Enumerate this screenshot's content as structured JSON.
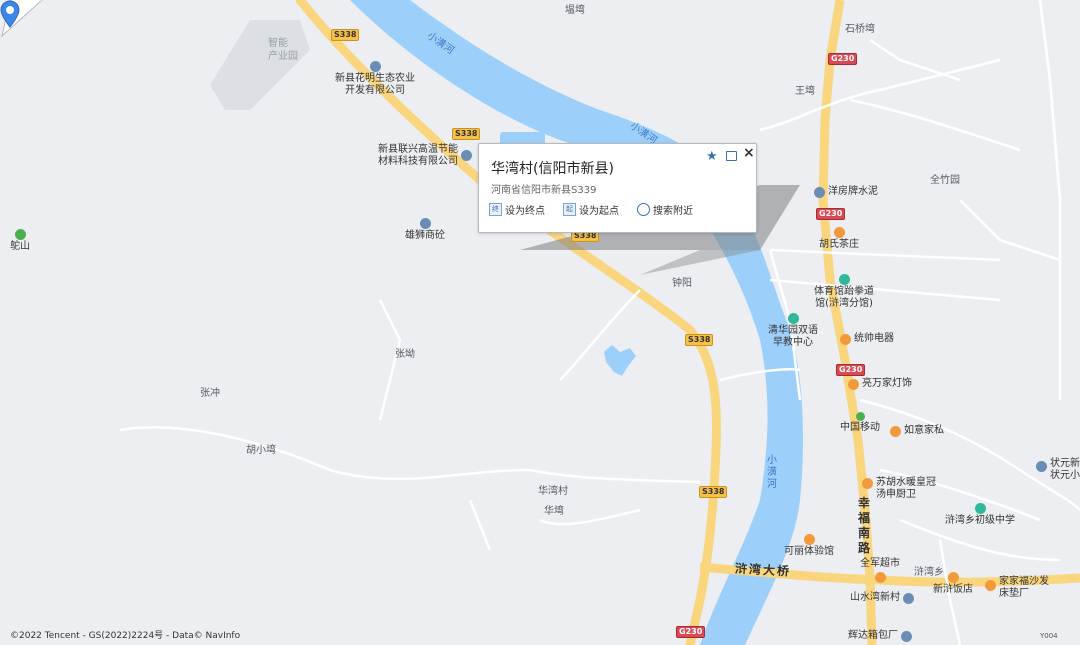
{
  "map": {
    "background": "#eceef1",
    "water_color": "#9cd0fb",
    "road_color": "#f9d67e",
    "copyright": "©2022 Tencent - GS(2022)2224号 - Data© NavInfo",
    "corner_tag": "Y004"
  },
  "popup": {
    "title": "华湾村(信阳市新县)",
    "address": "河南省信阳市新县S339",
    "actions": [
      {
        "label": "设为终点",
        "icon": "endpoint-icon",
        "glyph": "终"
      },
      {
        "label": "设为起点",
        "icon": "startpoint-icon",
        "glyph": "起"
      },
      {
        "label": "搜索附近",
        "icon": "search-nearby-icon",
        "glyph": ""
      }
    ],
    "favorite_icon": "star-icon",
    "share_icon": "share-icon",
    "close_glyph": "×"
  },
  "shields": {
    "s338": "S338",
    "g230": "G230"
  },
  "labels": {
    "zhineng": "智能",
    "chanyeyuan": "产业园",
    "xiaohuang_river": "小潢河",
    "xiaohuang_river2": "小潢河",
    "xiaohuang_river3": "小潢河",
    "tangwan": "塭塆",
    "shiqiaowan": "石桥塆",
    "wangwan": "王塆",
    "quanzhuyuan": "全竹园",
    "zhongyang": "钟阳",
    "zhangwan": "张坳",
    "zhangchong": "张冲",
    "huxiaowan": "胡小塆",
    "huawancun": "华湾村",
    "huawan": "华塆",
    "xuwanxiang": "浒湾乡",
    "xuwanbridge": "浒湾大桥",
    "xingfu_road": "幸福南路",
    "shan": "鸵山"
  },
  "pois": [
    {
      "name": "新县花明生态农业开发有限公司",
      "lines": [
        "新县花明生态农业",
        "开发有限公司"
      ],
      "icon": "pin-icon"
    },
    {
      "name": "新县联兴高温节能材料科技有限公司",
      "lines": [
        "新县联兴高温节能",
        "材料科技有限公司"
      ],
      "icon": "pin-icon"
    },
    {
      "name": "雄狮商砼",
      "lines": [
        "雄狮商砼"
      ],
      "icon": "pin-icon"
    },
    {
      "name": "洋房牌水泥",
      "lines": [
        "洋房牌水泥"
      ],
      "icon": "pin-icon"
    },
    {
      "name": "胡氏茶庄",
      "lines": [
        "胡氏茶庄"
      ],
      "icon": "shop-icon"
    },
    {
      "name": "体育馆跆拳道馆(浒湾分馆)",
      "lines": [
        "体育馆跆拳道",
        "馆(浒湾分馆)"
      ],
      "icon": "sport-icon"
    },
    {
      "name": "清华园双语早教中心",
      "lines": [
        "清华园双语",
        "早教中心"
      ],
      "icon": "school-icon"
    },
    {
      "name": "统帅电器",
      "lines": [
        "统帅电器"
      ],
      "icon": "shop-icon"
    },
    {
      "name": "亮万家灯饰",
      "lines": [
        "亮万家灯饰"
      ],
      "icon": "shop-icon"
    },
    {
      "name": "中国移动",
      "lines": [
        "中国移动"
      ],
      "icon": "mobile-icon"
    },
    {
      "name": "如意家私",
      "lines": [
        "如意家私"
      ],
      "icon": "shop-icon"
    },
    {
      "name": "苏胡水暖皇冠汤申厨卫",
      "lines": [
        "苏胡水暖皇冠",
        "汤申厨卫"
      ],
      "icon": "shop-icon"
    },
    {
      "name": "浒湾乡初级中学",
      "lines": [
        "浒湾乡初级中学"
      ],
      "icon": "school-icon"
    },
    {
      "name": "可丽体验馆",
      "lines": [
        "可丽体验馆"
      ],
      "icon": "shop-icon"
    },
    {
      "name": "全军超市",
      "lines": [
        "全军超市"
      ],
      "icon": "shop-icon"
    },
    {
      "name": "新浒饭店",
      "lines": [
        "新浒饭店"
      ],
      "icon": "restaurant-icon"
    },
    {
      "name": "家家福沙发床垫厂",
      "lines": [
        "家家福沙发",
        "床垫厂"
      ],
      "icon": "shop-icon"
    },
    {
      "name": "山水湾新村",
      "lines": [
        "山水湾新村"
      ],
      "icon": "residential-icon"
    },
    {
      "name": "状元新",
      "lines": [
        "状元新",
        "状元小"
      ],
      "icon": "residential-icon"
    },
    {
      "name": "辉达箱包厂",
      "lines": [
        "辉达箱包厂"
      ],
      "icon": "pin-icon"
    },
    {
      "name": "鸵山",
      "lines": [
        "鸵山"
      ],
      "icon": "mountain-icon"
    }
  ]
}
